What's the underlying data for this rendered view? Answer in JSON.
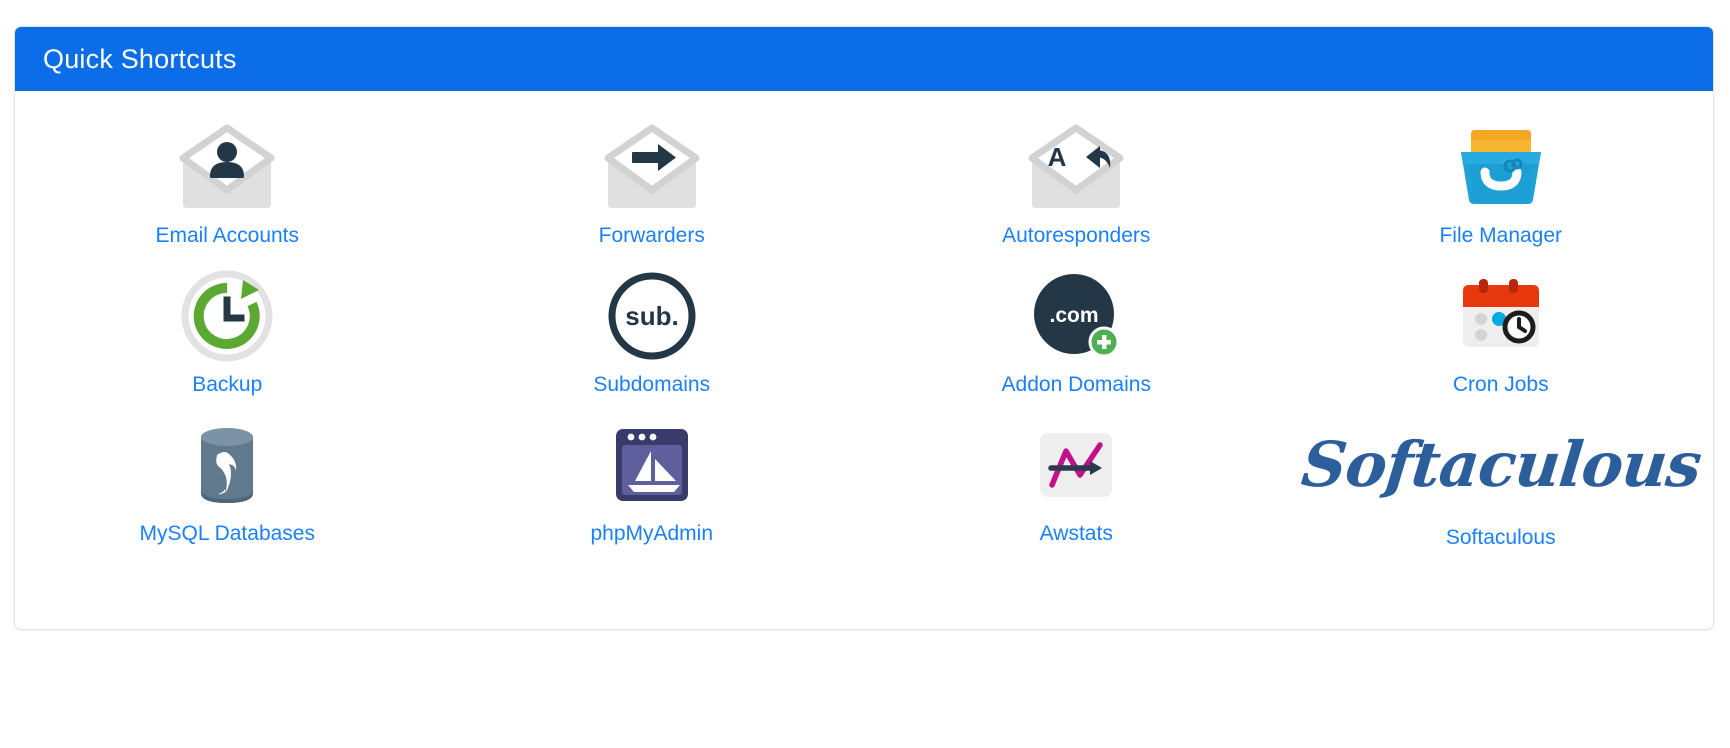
{
  "panel": {
    "title": "Quick Shortcuts",
    "header_bg": "#0B6EE8",
    "header_text_color": "#ffffff",
    "link_color": "#1A80FB",
    "card_bg": "#ffffff",
    "card_border": "#e3e3e3"
  },
  "shortcuts": [
    {
      "label": "Email Accounts",
      "icon": "envelope-user-icon"
    },
    {
      "label": "Forwarders",
      "icon": "envelope-arrow-icon"
    },
    {
      "label": "Autoresponders",
      "icon": "envelope-reply-icon"
    },
    {
      "label": "File Manager",
      "icon": "file-drawer-icon"
    },
    {
      "label": "Backup",
      "icon": "restore-clock-icon"
    },
    {
      "label": "Subdomains",
      "icon": "sub-circle-icon"
    },
    {
      "label": "Addon Domains",
      "icon": "dotcom-plus-icon"
    },
    {
      "label": "Cron Jobs",
      "icon": "calendar-clock-icon"
    },
    {
      "label": "MySQL Databases",
      "icon": "database-dolphin-icon"
    },
    {
      "label": "phpMyAdmin",
      "icon": "phpmyadmin-sailboat-icon"
    },
    {
      "label": "Awstats",
      "icon": "awstats-chart-icon"
    },
    {
      "label": "Softaculous",
      "icon": "softaculous-logo-icon",
      "logo_text": "Softaculous"
    }
  ]
}
